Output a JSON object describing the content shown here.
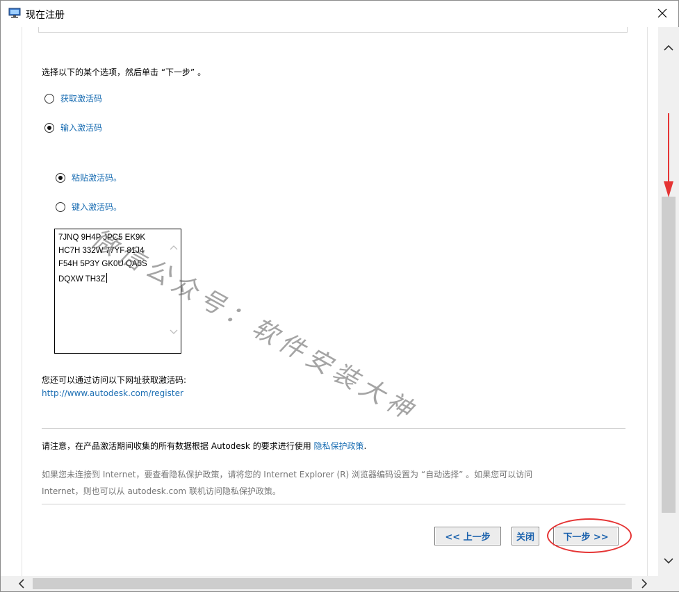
{
  "window": {
    "title": "现在注册",
    "icon": "monitor-app-icon"
  },
  "main": {
    "instruction": "选择以下的某个选项，然后单击 “下一步” 。",
    "options": [
      {
        "label": "获取激活码",
        "checked": false
      },
      {
        "label": "输入激活码",
        "checked": true
      }
    ],
    "sub_options": [
      {
        "label": "粘贴激活码。",
        "checked": true
      },
      {
        "label": "键入激活码。",
        "checked": false
      }
    ],
    "activation_code_lines": [
      "7JNQ 9H4P JPC5 EK9K",
      "HC7H 332W 77YF 81J4",
      "F54H 5P3Y GK0U QA5S",
      "DQXW TH3Z"
    ],
    "visit_text": "您还可以通过访问以下网址获取激活码:",
    "url": "http://www.autodesk.com/register",
    "notice_prefix": "请注意，在产品激活期间收集的所有数据根据 Autodesk 的要求进行使用",
    "privacy_link": "隐私保护政策",
    "notice_suffix": ".",
    "gray_note_line1": "如果您未连接到 Internet，要查看隐私保护政策，请将您的 Internet Explorer (R) 浏览器编码设置为 “自动选择” 。如果您可以访问",
    "gray_note_line2": "Internet，则也可以从 autodesk.com 联机访问隐私保护政策。"
  },
  "buttons": {
    "back": "<< 上一步",
    "close": "关闭",
    "next": "下一步 >>"
  },
  "watermark": "微信公众号：软件安装大神",
  "annotation_color": "#e53434"
}
